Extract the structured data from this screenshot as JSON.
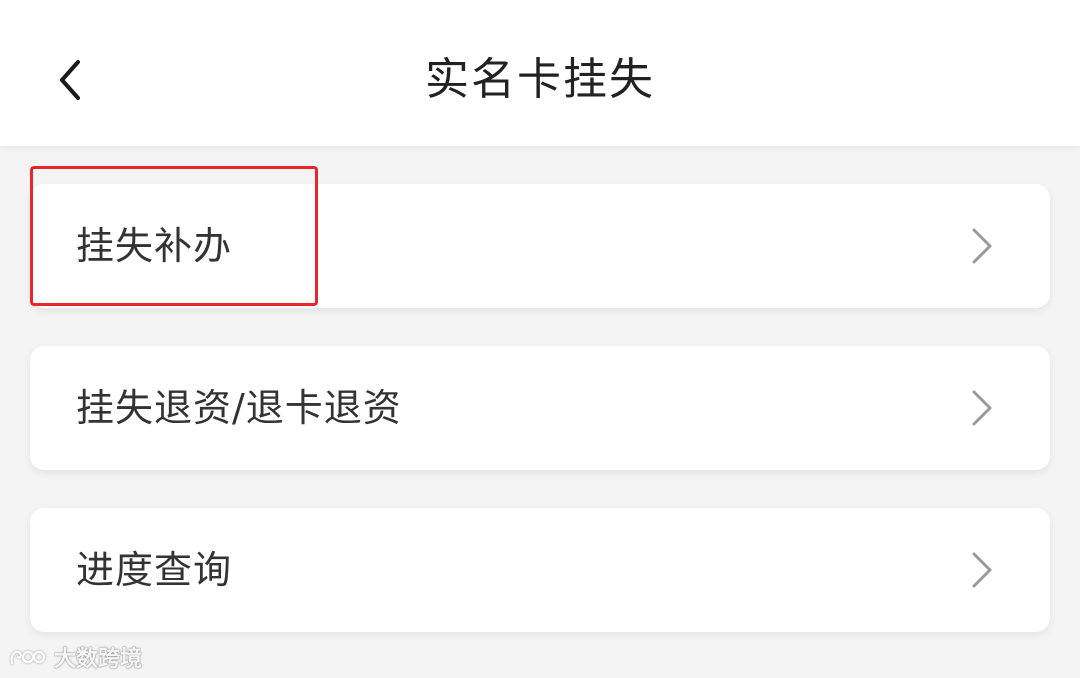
{
  "header": {
    "title": "实名卡挂失",
    "back_icon": "chevron-left-icon"
  },
  "menu": {
    "items": [
      {
        "label": "挂失补办",
        "icon": "chevron-right-icon",
        "highlighted": true
      },
      {
        "label": "挂失退资/退卡退资",
        "icon": "chevron-right-icon",
        "highlighted": false
      },
      {
        "label": "进度查询",
        "icon": "chevron-right-icon",
        "highlighted": false
      }
    ]
  },
  "annotation": {
    "highlight_color": "#e8262b"
  },
  "watermark": {
    "text": "大数跨境"
  },
  "colors": {
    "background": "#f4f4f4",
    "card": "#ffffff",
    "title_text": "#222222",
    "item_text": "#333333",
    "chevron": "#9a9a9a"
  }
}
